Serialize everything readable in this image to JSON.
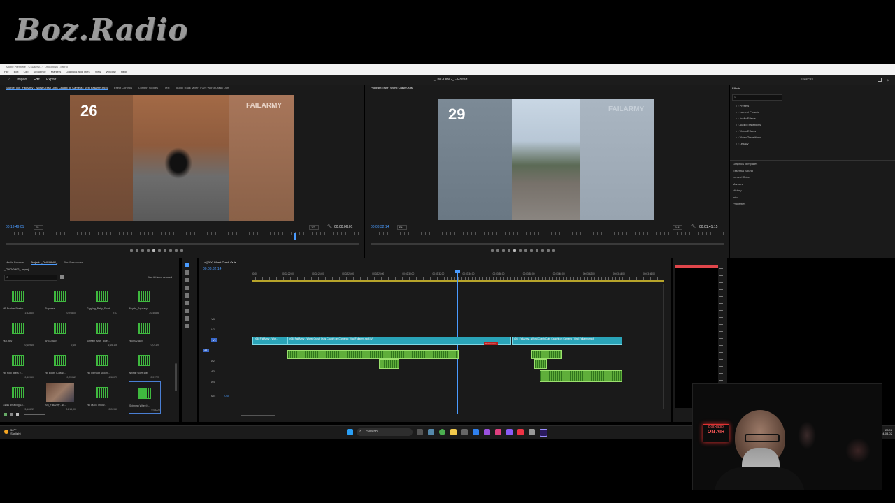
{
  "overlay": {
    "logo_text": "Boz.Radio"
  },
  "window": {
    "title": "Adobe Premiere - C:\\Users\\...\\_ONGOING_.prproj",
    "menu": [
      "File",
      "Edit",
      "Clip",
      "Sequence",
      "Markers",
      "Graphics and Titles",
      "View",
      "Window",
      "Help"
    ],
    "nav": [
      "Import",
      "Edit",
      "Export"
    ],
    "project_center": "_ONGOING_ - Edited",
    "effects_label": "EFFECTS"
  },
  "source_monitor": {
    "tabs": [
      "Source: v06_FailArmy - Worst Crash Outs Caught on Camera : Viral Failarmy.mp4",
      "Effect Controls",
      "Lumetri Scopes",
      "Text",
      "Audio Track Mixer: [FAY] Worst Crash Outs"
    ],
    "overlay_number": "26",
    "watermark": "FAILARMY",
    "timecode_left": "00;19;49;01",
    "fit": "Fit",
    "ratio": "1/2",
    "timecode_right": "00;00;06;01"
  },
  "program_monitor": {
    "tab": "Program: [FAY] Worst Crash Outs",
    "overlay_number": "29",
    "watermark": "FAILARMY",
    "timecode_left": "00;03;32;14",
    "fit": "Fit",
    "quality": "Full",
    "timecode_right": "00;01;41;15"
  },
  "effects_panel": {
    "title": "Effects",
    "items": [
      "Presets",
      "Lumetri Presets",
      "Audio Effects",
      "Audio Transitions",
      "Video Effects",
      "Video Transitions",
      "Legacy"
    ],
    "side_panels": [
      "Graphics Templates",
      "Essential Sound",
      "Lumetri Color",
      "Markers",
      "History",
      "Info",
      "Properties"
    ]
  },
  "project_panel": {
    "tabs": [
      "Media Browser",
      "Project: _ONGOING_",
      "Bin: Resources"
    ],
    "project_file": "_ONGOING_.prproj",
    "count": "1 of 40 items selected",
    "items": [
      {
        "name": "HB Rubber Stretch...",
        "dur": "1;42860",
        "type": "audio"
      },
      {
        "name": "Slapness",
        "dur": "0;29800",
        "type": "audio"
      },
      {
        "name": "Giggling_Baby_Short...",
        "dur": "2;07",
        "type": "audio"
      },
      {
        "name": "Bicycle_Squeaky...",
        "dur": "20;46898",
        "type": "audio"
      },
      {
        "name": "Hull.wav",
        "dur": "0;18945",
        "type": "audio"
      },
      {
        "name": "ARG0.wav",
        "dur": "0;15",
        "type": "audio"
      },
      {
        "name": "Scream_Man_Blue...",
        "dur": "1;16;106",
        "type": "audio"
      },
      {
        "name": "HB0002.wav",
        "dur": "0;01125",
        "type": "audio"
      },
      {
        "name": "HB Pool (Bass e...",
        "dur": "0;40960",
        "type": "audio"
      },
      {
        "name": "HB Booth (Cheap...",
        "dur": "0;25012",
        "type": "audio"
      },
      {
        "name": "HB Interrupt Spoon...",
        "dur": "4;58077",
        "type": "audio"
      },
      {
        "name": "Whistle Goes.wav",
        "dur": "0;01725",
        "type": "audio"
      },
      {
        "name": "Glass Breaking Lo...",
        "dur": "3;16622",
        "type": "audio"
      },
      {
        "name": "v06_FailArmy - W...",
        "dur": "24;13;00",
        "type": "video"
      },
      {
        "name": "HB Quick Throw...",
        "dur": "0;26960",
        "type": "audio"
      },
      {
        "name": "Spinning Wheel f...",
        "dur": "9;05220",
        "type": "audio"
      }
    ]
  },
  "timeline": {
    "tab": "[FAY] Worst Crash Outs",
    "timecode": "00;03;32;14",
    "ruler_labels": [
      "00;00",
      "00;02;22;00",
      "00;02;24;00",
      "00;02;26;00",
      "00;02;28;00",
      "00;02;30;00",
      "00;03;32;00",
      "00;03;34;00",
      "00;03;36;00",
      "00;03;38;00",
      "00;03;40;00",
      "00;03;42;00",
      "00;03;44;00",
      "00;03;46;00"
    ],
    "video_tracks": [
      "V3",
      "V2",
      "V1"
    ],
    "audio_tracks": [
      "A1",
      "A2",
      "A3",
      "A4"
    ],
    "mix_label": "Mix",
    "mix_value": "0.0",
    "clips": {
      "v1_a": "v06_FailArmy - Wor...",
      "v1_b": "v06_FailArmy - Worst Crash Outs Caught on Camera : Viral Failarmy.mp4 [V]",
      "v1_c": "v06_FailArmy - Worst Crash Outs Caught on Camera : Viral Failarmy.mp4",
      "v1_marker": "Unrendered"
    }
  },
  "taskbar": {
    "weather_temp": "56°F",
    "weather_cond": "Sunlight",
    "search_label": "Search",
    "time": "23:06",
    "date": "2024-08-02"
  },
  "webcam": {
    "neon_sign": "BozRadio",
    "neon_sign2": "ON AIR"
  }
}
